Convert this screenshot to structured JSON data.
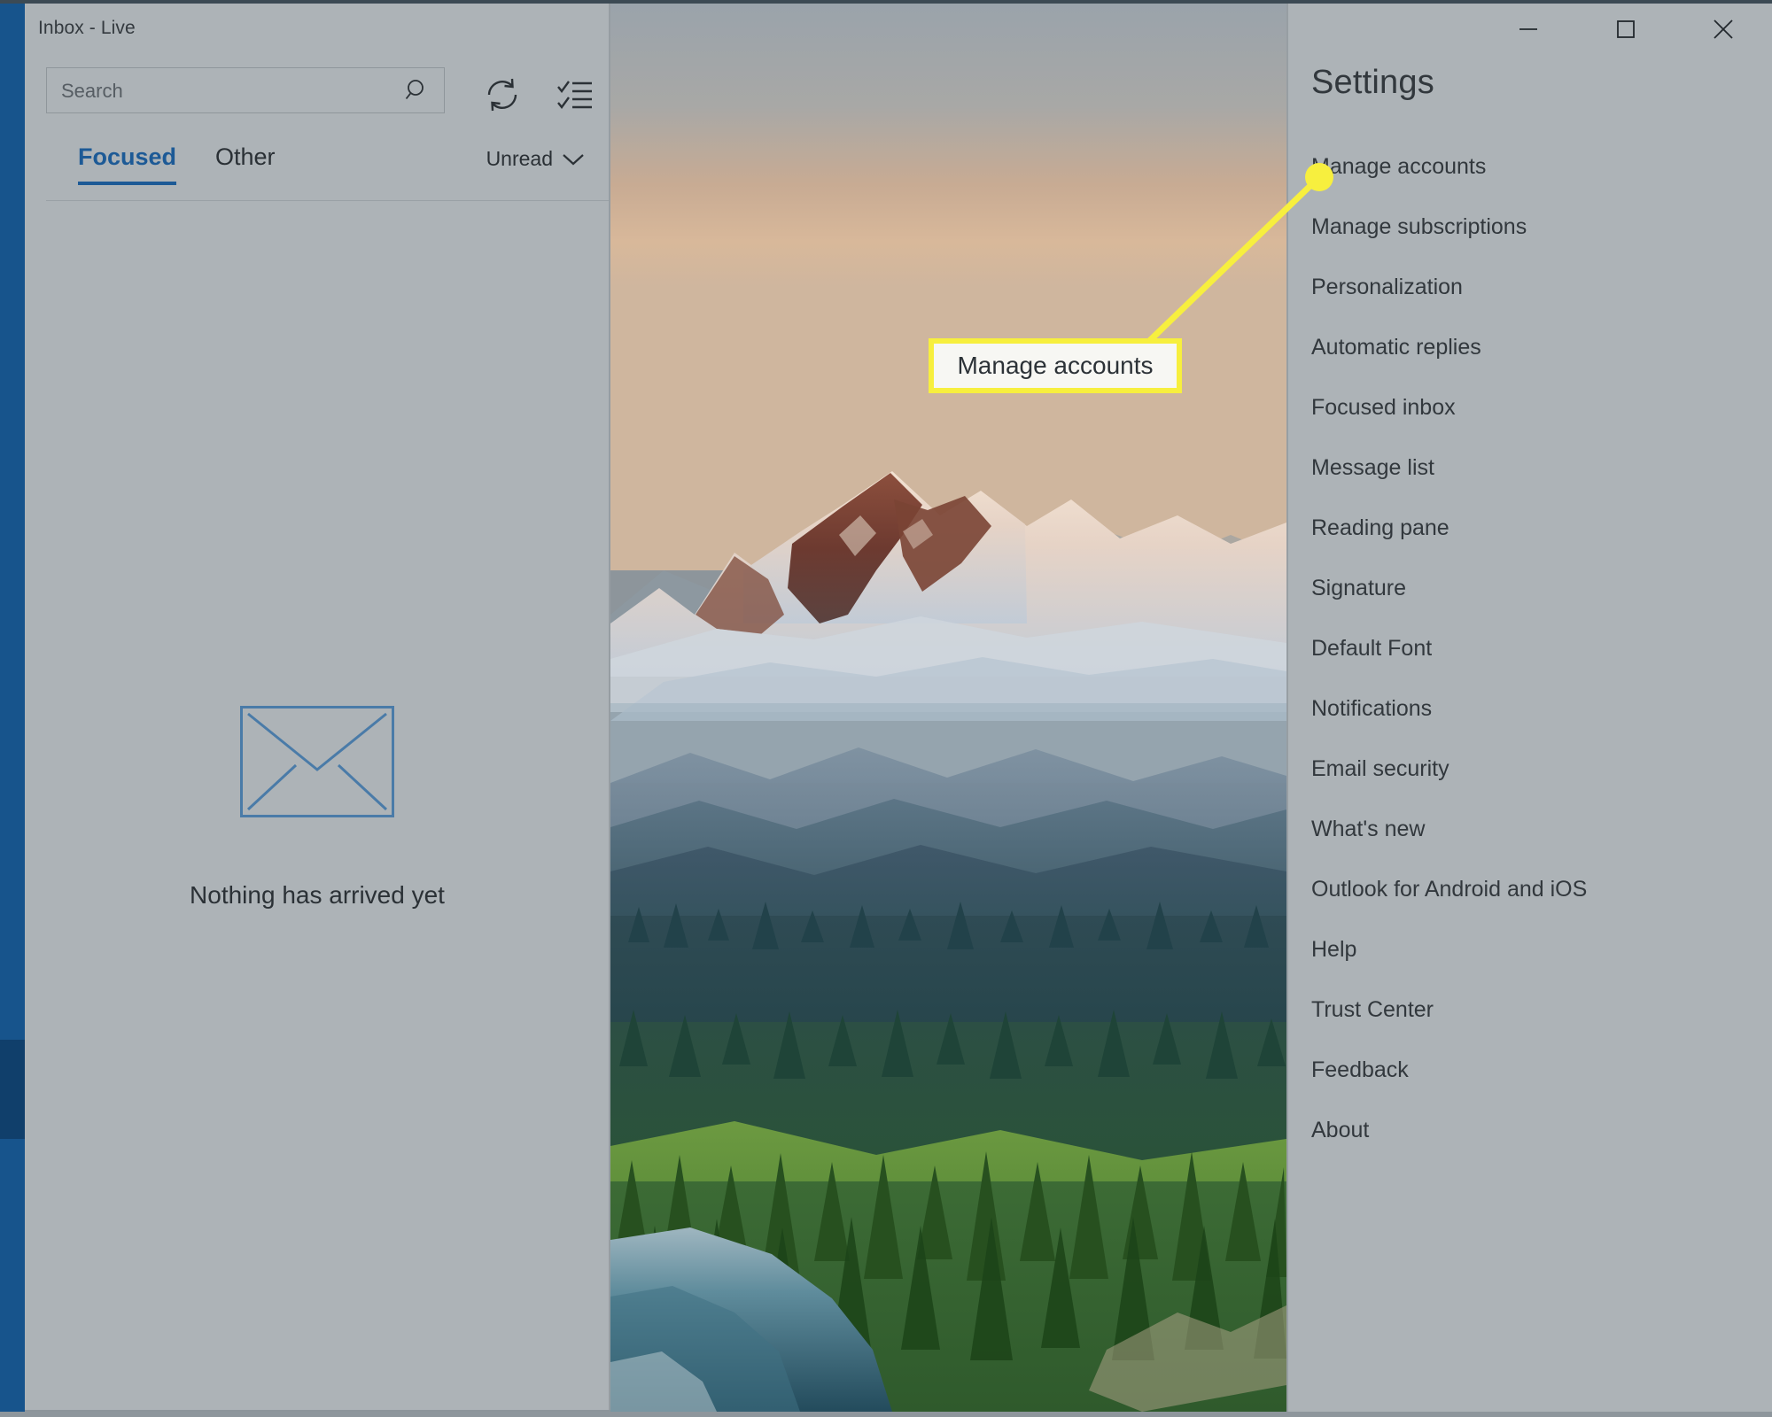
{
  "window": {
    "title": "Inbox - Live",
    "controls": [
      {
        "name": "minimize",
        "glyph": "minimize-icon"
      },
      {
        "name": "maximize",
        "glyph": "maximize-icon"
      },
      {
        "name": "close",
        "glyph": "close-icon"
      }
    ]
  },
  "mail_pane": {
    "search": {
      "placeholder": "Search",
      "value": "",
      "icon": "search-icon"
    },
    "toolbar": [
      {
        "name": "sync",
        "icon": "refresh-icon"
      },
      {
        "name": "selection-mode",
        "icon": "checklist-icon"
      }
    ],
    "tabs": [
      {
        "label": "Focused",
        "active": true
      },
      {
        "label": "Other",
        "active": false
      }
    ],
    "filter": {
      "label": "Unread",
      "icon": "chevron-down-icon"
    },
    "empty_state": {
      "icon": "envelope-icon",
      "message": "Nothing has arrived yet"
    }
  },
  "settings": {
    "title": "Settings",
    "items": [
      {
        "label": "Manage accounts"
      },
      {
        "label": "Manage subscriptions"
      },
      {
        "label": "Personalization"
      },
      {
        "label": "Automatic replies"
      },
      {
        "label": "Focused inbox"
      },
      {
        "label": "Message list"
      },
      {
        "label": "Reading pane"
      },
      {
        "label": "Signature"
      },
      {
        "label": "Default Font"
      },
      {
        "label": "Notifications"
      },
      {
        "label": "Email security"
      },
      {
        "label": "What's new"
      },
      {
        "label": "Outlook for Android and iOS"
      },
      {
        "label": "Help"
      },
      {
        "label": "Trust Center"
      },
      {
        "label": "Feedback"
      },
      {
        "label": "About"
      }
    ]
  },
  "annotation": {
    "callout_text": "Manage accounts",
    "highlight_color": "#f7ef3e",
    "target_item": "Manage accounts"
  },
  "colors": {
    "accent_blue": "#17548c",
    "tab_active_blue": "#1d5a96",
    "pane_gray": "#adb3b7",
    "envelope_blue": "#4a7ba8",
    "annotation_yellow": "#f7ef3e"
  }
}
